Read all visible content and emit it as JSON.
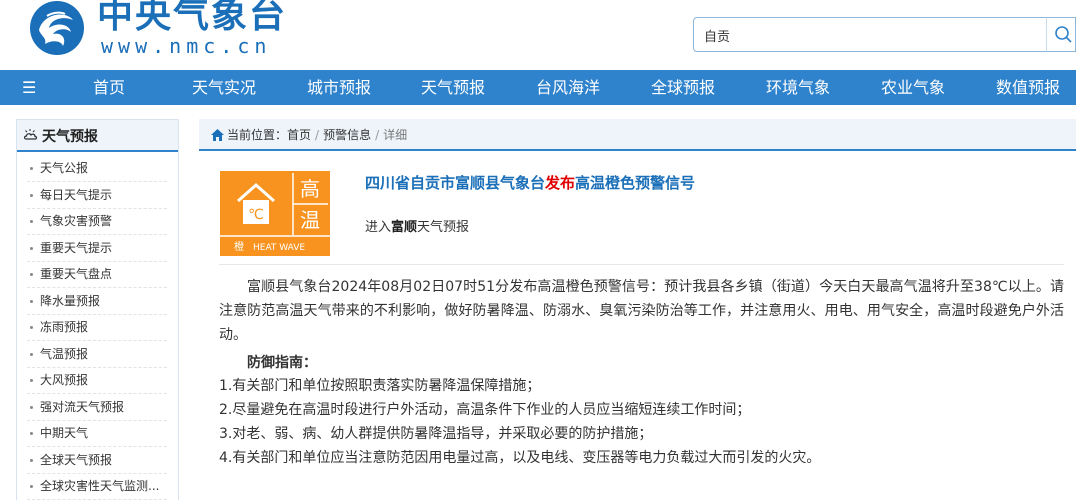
{
  "site": {
    "logo_cn": "中央气象台",
    "logo_en": "www.nmc.cn",
    "brand_color": "#1a6fb8"
  },
  "search": {
    "value": "自贡",
    "icon": "search-icon"
  },
  "nav": {
    "menu_icon": "☰",
    "items": [
      "首页",
      "天气实况",
      "城市预报",
      "天气预报",
      "台风海洋",
      "全球预报",
      "环境气象",
      "农业气象",
      "数值预报"
    ],
    "bg_color": "#2f83cc"
  },
  "sidebar": {
    "title": "天气预报",
    "items": [
      "天气公报",
      "每日天气提示",
      "气象灾害预警",
      "重要天气提示",
      "重要天气盘点",
      "降水量预报",
      "冻雨预报",
      "气温预报",
      "大风预报",
      "强对流天气预报",
      "中期天气",
      "全球天气预报",
      "全球灾害性天气监测..."
    ]
  },
  "breadcrumb": {
    "prefix": "当前位置：",
    "items": [
      "首页",
      "预警信息",
      "详细"
    ]
  },
  "warning": {
    "icon": {
      "chars": [
        "高",
        "温"
      ],
      "unit": "℃",
      "level": "橙",
      "label": "HEAT WAVE",
      "color": "#f7931e"
    },
    "title_part1": "四川省自贡市富顺县气象台",
    "title_part2": "发布",
    "title_part3": "高温橙色预警信号",
    "enter_prefix": "进入",
    "enter_place": "富顺",
    "enter_suffix": "天气预报",
    "body": "富顺县气象台2024年08月02日07时51分发布高温橙色预警信号：预计我县各乡镇（街道）今天白天最高气温将升至38℃以上。请注意防范高温天气带来的不利影响，做好防暑降温、防溺水、臭氧污染防治等工作，并注意用火、用电、用气安全，高温时段避免户外活动。",
    "guide_title": "防御指南：",
    "guides": [
      "1.有关部门和单位按照职责落实防暑降温保障措施；",
      "2.尽量避免在高温时段进行户外活动，高温条件下作业的人员应当缩短连续工作时间；",
      "3.对老、弱、病、幼人群提供防暑降温指导，并采取必要的防护措施；",
      "4.有关部门和单位应当注意防范因用电量过高，以及电线、变压器等电力负载过大而引发的火灾。"
    ]
  }
}
